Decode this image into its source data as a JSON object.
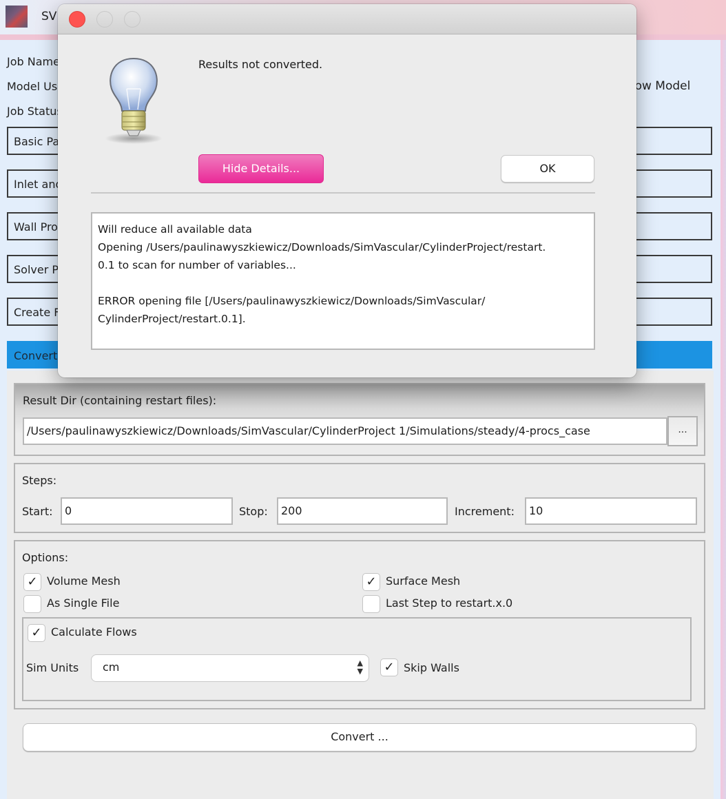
{
  "app": {
    "title": "SV",
    "fields": {
      "job_name_label": "Job Name",
      "model_used_label": "Model Used",
      "job_status_label": "Job Status"
    },
    "show_model_label": "Show Model",
    "sections": [
      {
        "label": "Basic Parameters",
        "active": false
      },
      {
        "label": "Inlet and Outlet BCs",
        "active": false
      },
      {
        "label": "Wall Properties",
        "active": false
      },
      {
        "label": "Solver Parameters",
        "active": false
      },
      {
        "label": "Create Files and Run Simulation",
        "active": false
      },
      {
        "label": "Convert Results",
        "active": true
      }
    ],
    "accent_color": "#1c93e2"
  },
  "convert": {
    "result_dir_label": "Result Dir (containing restart files):",
    "result_dir_value": "/Users/paulinawyszkiewicz/Downloads/SimVascular/CylinderProject 1/Simulations/steady/4-procs_case",
    "browse_label": "...",
    "steps_label": "Steps:",
    "start_label": "Start:",
    "start_value": "0",
    "stop_label": "Stop:",
    "stop_value": "200",
    "increment_label": "Increment:",
    "increment_value": "10",
    "options_label": "Options:",
    "options": {
      "volume_mesh": {
        "label": "Volume Mesh",
        "checked": true
      },
      "surface_mesh": {
        "label": "Surface Mesh",
        "checked": true
      },
      "single_file": {
        "label": "As Single File",
        "checked": false
      },
      "last_step": {
        "label": "Last Step to restart.x.0",
        "checked": false
      },
      "calculate_flows": {
        "label": "Calculate Flows",
        "checked": true
      },
      "skip_walls": {
        "label": "Skip Walls",
        "checked": true
      }
    },
    "sim_units_label": "Sim Units",
    "sim_units_value": "cm",
    "convert_button": "Convert ..."
  },
  "dialog": {
    "message": "Results not converted.",
    "hide_details_button": "Hide Details...",
    "ok_button": "OK",
    "hide_details_color": "#ea2a98",
    "details_lines": [
      "Will reduce all available data",
      "Opening /Users/paulinawyszkiewicz/Downloads/SimVascular/CylinderProject/restart.",
      "0.1 to scan for number of variables...",
      "",
      "ERROR opening file [/Users/paulinawyszkiewicz/Downloads/SimVascular/",
      "CylinderProject/restart.0.1]."
    ]
  },
  "icons": {
    "check": "✓",
    "select_arrows": "⌃⌄"
  }
}
